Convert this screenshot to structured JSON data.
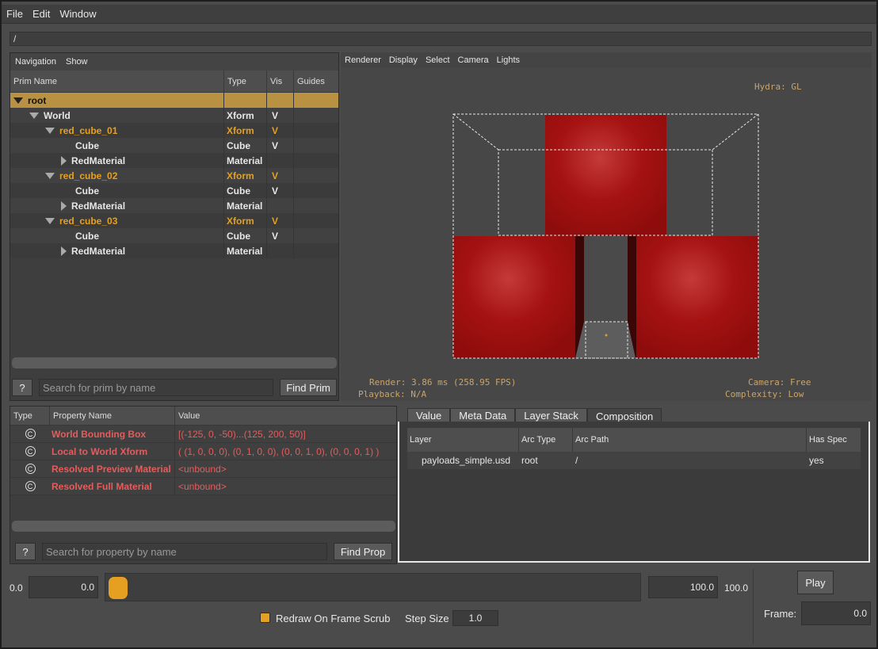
{
  "menu": [
    "File",
    "Edit",
    "Window"
  ],
  "path": "/",
  "tree": {
    "tabs": [
      "Navigation",
      "Show"
    ],
    "columns": [
      "Prim Name",
      "Type",
      "Vis",
      "Guides"
    ],
    "rows": [
      {
        "name": "root",
        "type": "",
        "vis": "",
        "indent": 0,
        "arrow": "down",
        "style": "sel"
      },
      {
        "name": "World",
        "type": "Xform",
        "vis": "V",
        "indent": 1,
        "arrow": "down",
        "style": "white"
      },
      {
        "name": "red_cube_01",
        "type": "Xform",
        "vis": "V",
        "indent": 2,
        "arrow": "down",
        "style": "orange"
      },
      {
        "name": "Cube",
        "type": "Cube",
        "vis": "V",
        "indent": 3,
        "arrow": "",
        "style": "white"
      },
      {
        "name": "RedMaterial",
        "type": "Material",
        "vis": "",
        "indent": 3,
        "arrow": "right",
        "style": "white"
      },
      {
        "name": "red_cube_02",
        "type": "Xform",
        "vis": "V",
        "indent": 2,
        "arrow": "down",
        "style": "orange"
      },
      {
        "name": "Cube",
        "type": "Cube",
        "vis": "V",
        "indent": 3,
        "arrow": "",
        "style": "white"
      },
      {
        "name": "RedMaterial",
        "type": "Material",
        "vis": "",
        "indent": 3,
        "arrow": "right",
        "style": "white"
      },
      {
        "name": "red_cube_03",
        "type": "Xform",
        "vis": "V",
        "indent": 2,
        "arrow": "down",
        "style": "orange"
      },
      {
        "name": "Cube",
        "type": "Cube",
        "vis": "V",
        "indent": 3,
        "arrow": "",
        "style": "white"
      },
      {
        "name": "RedMaterial",
        "type": "Material",
        "vis": "",
        "indent": 3,
        "arrow": "right",
        "style": "white"
      }
    ],
    "help": "?",
    "search_placeholder": "Search for prim by name",
    "find_button": "Find Prim"
  },
  "viewport": {
    "menu": [
      "Renderer",
      "Display",
      "Select",
      "Camera",
      "Lights"
    ],
    "renderer_label": "Hydra: GL",
    "render_stats": "Render: 3.86 ms (258.95 FPS)",
    "playback": "Playback: N/A",
    "camera": "Camera: Free",
    "complexity": "Complexity: Low"
  },
  "properties": {
    "columns": [
      "Type",
      "Property Name",
      "Value"
    ],
    "rows": [
      {
        "icon": "C",
        "name": "World Bounding Box",
        "value": "[(-125, 0, -50)...(125, 200, 50)]"
      },
      {
        "icon": "C",
        "name": "Local to World Xform",
        "value": "( (1, 0, 0, 0), (0, 1, 0, 0), (0, 0, 1, 0), (0, 0, 0, 1) )"
      },
      {
        "icon": "C",
        "name": "Resolved Preview Material",
        "value": "<unbound>"
      },
      {
        "icon": "C",
        "name": "Resolved Full Material",
        "value": "<unbound>"
      }
    ],
    "help": "?",
    "search_placeholder": "Search for property by name",
    "find_button": "Find Prop"
  },
  "composition": {
    "tabs": [
      "Value",
      "Meta Data",
      "Layer Stack",
      "Composition"
    ],
    "active_tab": "Composition",
    "columns": [
      "Layer",
      "Arc Type",
      "Arc Path",
      "Has Spec"
    ],
    "rows": [
      {
        "layer": "payloads_simple.usd",
        "arc_type": "root",
        "arc_path": "/",
        "has_spec": "yes"
      }
    ]
  },
  "timeline": {
    "start_label": "0.0",
    "start_value": "0.0",
    "end_value": "100.0",
    "end_label": "100.0",
    "slider_fraction": 0.0,
    "play_button": "Play",
    "redraw_label": "Redraw On Frame Scrub",
    "redraw_checked": true,
    "step_label": "Step Size",
    "step_value": "1.0",
    "frame_label": "Frame:",
    "frame_value": "0.0"
  },
  "colors": {
    "accent": "#e5a021",
    "selection": "#b89143",
    "property_text": "#e35d5d",
    "cube_red": "#b01010"
  }
}
